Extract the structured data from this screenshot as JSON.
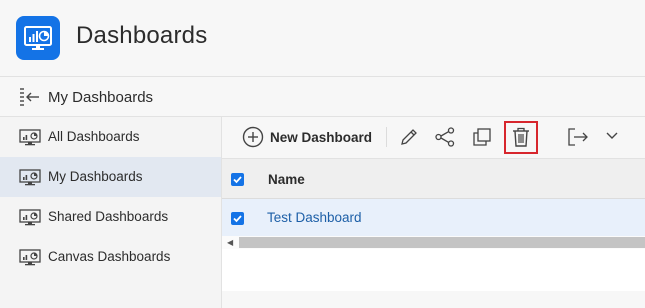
{
  "header": {
    "title": "Dashboards",
    "logo_icon": "dashboard-app-icon",
    "logo_color": "#1473e6"
  },
  "subheader": {
    "title": "My Dashboards",
    "collapse_icon": "collapse-left-icon"
  },
  "sidebar": {
    "items": [
      {
        "label": "All Dashboards",
        "icon": "dashboard-icon",
        "selected": false
      },
      {
        "label": "My Dashboards",
        "icon": "dashboard-icon",
        "selected": true
      },
      {
        "label": "Shared Dashboards",
        "icon": "dashboard-icon",
        "selected": false
      },
      {
        "label": "Canvas Dashboards",
        "icon": "dashboard-icon",
        "selected": false
      }
    ]
  },
  "toolbar": {
    "new_label": "New Dashboard",
    "icons": [
      "add-circle-icon",
      "edit-pencil-icon",
      "share-icon",
      "duplicate-icon",
      "delete-trash-icon",
      "move-icon",
      "chevron-down-icon"
    ],
    "highlight_color": "#d7262d"
  },
  "table": {
    "columns": [
      "Name"
    ],
    "rows": [
      {
        "name": "Test Dashboard",
        "checked": true
      }
    ],
    "header_checked": true
  }
}
